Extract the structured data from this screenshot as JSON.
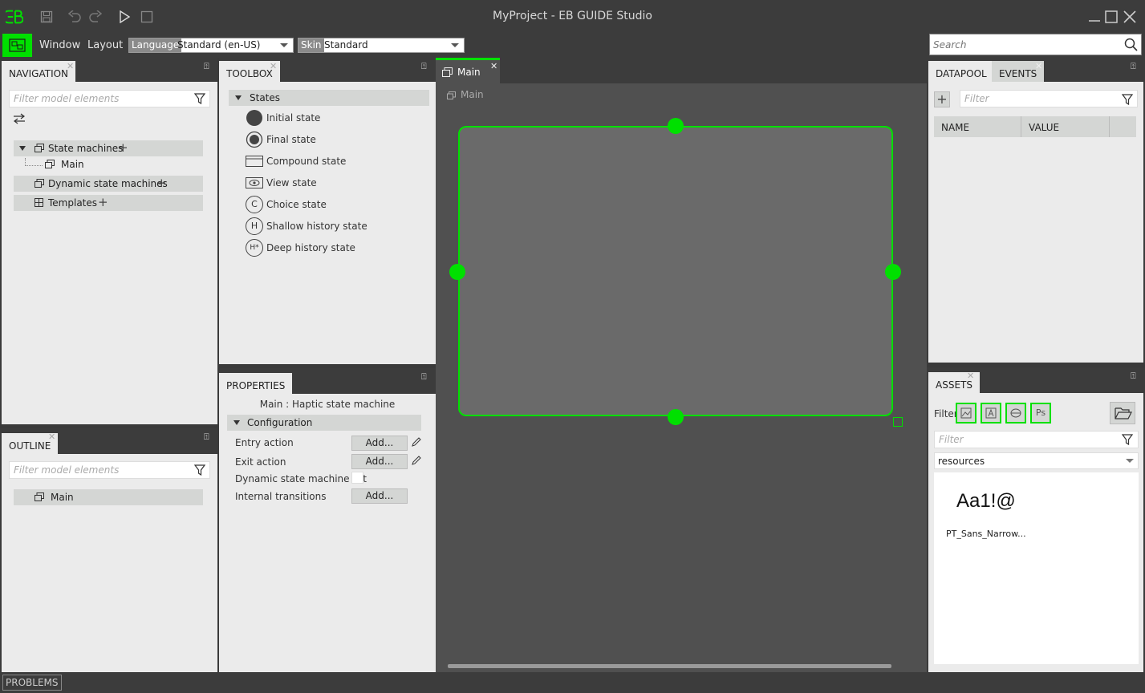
{
  "app": {
    "title": "MyProject - EB GUIDE Studio"
  },
  "colors": {
    "accent": "#00e000",
    "chrome": "#3c3c3c",
    "panel": "#ebebeb",
    "canvas": "#505050"
  },
  "menu": {
    "window": "Window",
    "layout": "Layout"
  },
  "language": {
    "tag": "Language",
    "value": "Standard (en-US)"
  },
  "skin": {
    "tag": "Skin",
    "value": "Standard"
  },
  "search": {
    "placeholder": "Search"
  },
  "navigation": {
    "tab": "NAVIGATION",
    "filter_placeholder": "Filter model elements",
    "items": [
      {
        "label": "State machines"
      },
      {
        "label": "Main"
      },
      {
        "label": "Dynamic state machines"
      },
      {
        "label": "Templates"
      }
    ]
  },
  "outline": {
    "tab": "OUTLINE",
    "filter_placeholder": "Filter model elements",
    "items": [
      {
        "label": "Main"
      }
    ]
  },
  "toolbox": {
    "tab": "TOOLBOX",
    "group": "States",
    "items": [
      {
        "label": "Initial state",
        "icon": "filled-circle-icon"
      },
      {
        "label": "Final state",
        "icon": "ring-circle-icon"
      },
      {
        "label": "Compound state",
        "icon": "rectangle-icon"
      },
      {
        "label": "View state",
        "icon": "eye-icon"
      },
      {
        "label": "Choice state",
        "icon": "c-circle-icon",
        "glyph": "C"
      },
      {
        "label": "Shallow history state",
        "icon": "h-circle-icon",
        "glyph": "H"
      },
      {
        "label": "Deep history state",
        "icon": "h-star-circle-icon",
        "glyph": "H*"
      }
    ]
  },
  "properties": {
    "tab": "PROPERTIES",
    "subtitle": "Main : Haptic state machine",
    "group": "Configuration",
    "rows": [
      {
        "label": "Entry action",
        "button": "Add..."
      },
      {
        "label": "Exit action",
        "button": "Add..."
      },
      {
        "label": "Dynamic state machine list"
      },
      {
        "label": "Internal transitions",
        "button": "Add..."
      }
    ]
  },
  "editor": {
    "tab": "Main",
    "breadcrumb": "Main"
  },
  "datapool": {
    "tab": "DATAPOOL",
    "tab2": "EVENTS",
    "filter_placeholder": "Filter",
    "columns": [
      "NAME",
      "VALUE"
    ]
  },
  "assets": {
    "tab": "ASSETS",
    "filter_label": "Filter",
    "filter_buttons": [
      "image-filter-icon",
      "font-filter-icon",
      "mesh-filter-icon",
      "Ps"
    ],
    "filter_placeholder": "Filter",
    "folder": "resources",
    "preview": "Aa1!@",
    "asset_name": "PT_Sans_Narrow..."
  },
  "statusbar": {
    "problems": "PROBLEMS"
  }
}
